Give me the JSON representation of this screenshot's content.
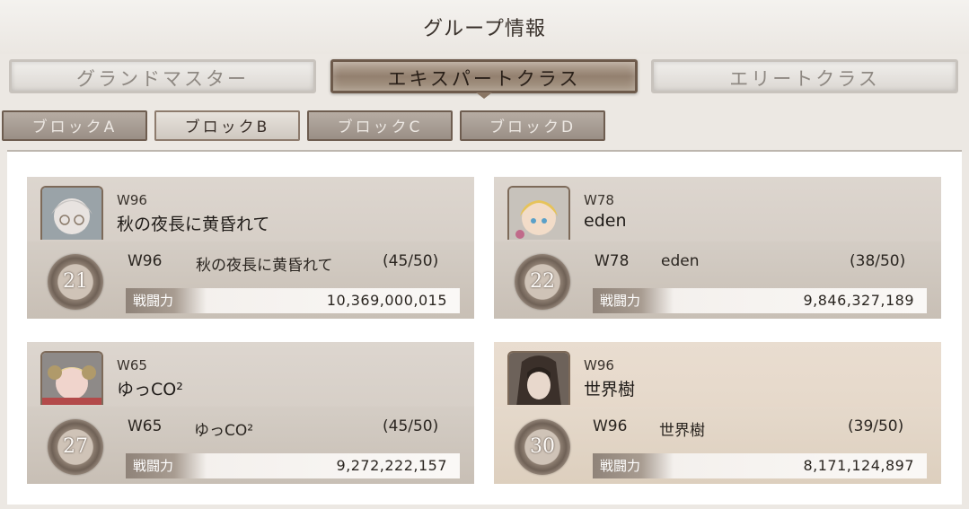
{
  "header": {
    "title": "グループ情報"
  },
  "tabs": [
    {
      "label": "グランドマスター",
      "active": false
    },
    {
      "label": "エキスパートクラス",
      "active": true
    },
    {
      "label": "エリートクラス",
      "active": false
    }
  ],
  "blocks": [
    {
      "label": "ブロックA",
      "active": false
    },
    {
      "label": "ブロックB",
      "active": true
    },
    {
      "label": "ブロックC",
      "active": false
    },
    {
      "label": "ブロックD",
      "active": false
    }
  ],
  "power_label": "戦闘力",
  "guilds": [
    {
      "rank": "21",
      "world": "W96",
      "name": "秋の夜長に黄昏れて",
      "members": "(45/50)",
      "power": "10,369,000,015",
      "highlighted": false
    },
    {
      "rank": "22",
      "world": "W78",
      "name": "eden",
      "members": "(38/50)",
      "power": "9,846,327,189",
      "highlighted": false
    },
    {
      "rank": "27",
      "world": "W65",
      "name": "ゆっCO²",
      "members": "(45/50)",
      "power": "9,272,222,157",
      "highlighted": false
    },
    {
      "rank": "30",
      "world": "W96",
      "name": "世界樹",
      "members": "(39/50)",
      "power": "8,171,124,897",
      "highlighted": true
    }
  ],
  "colors": {
    "accent_tab": "#93806f",
    "highlight_card": "#e9ddd0",
    "block_active": "#e7e2dc"
  }
}
